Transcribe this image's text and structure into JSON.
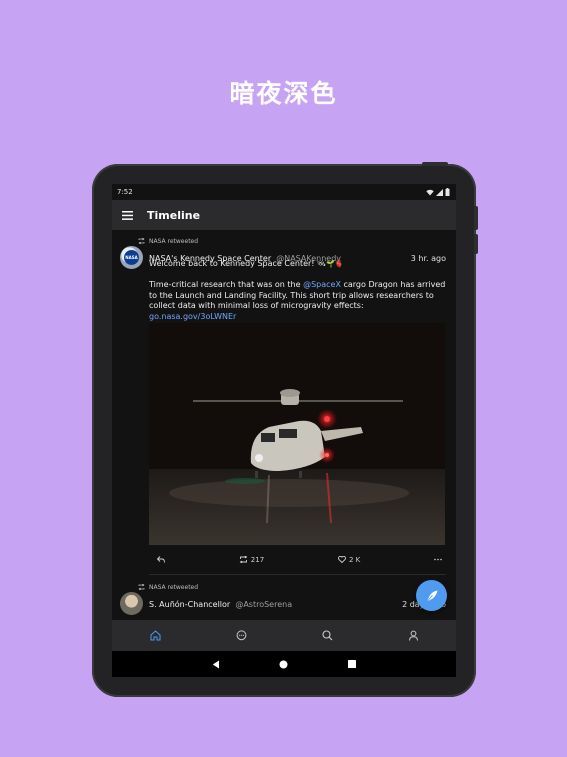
{
  "headline": "暗夜深色",
  "status_bar": {
    "time": "7:52"
  },
  "app_bar": {
    "title": "Timeline",
    "menu_icon": "hamburger-menu-icon"
  },
  "posts": [
    {
      "retweet_label": "NASA retweeted",
      "author_name": "NASA's Kennedy Space Center",
      "author_handle": "@NASAKennedy",
      "time": "3 hr. ago",
      "text_line1": "Welcome back to Kennedy Space Center!",
      "text_line1_emoji": "🛰🌱🫀",
      "text_para2_before_mention": "Time-critical research that was on the ",
      "mention": "@SpaceX",
      "text_para2_after_mention": " cargo Dragon has arrived to the Launch and Landing Facility. This short trip allows researchers to collect data with minimal loss of microgravity effects:",
      "link": "go.nasa.gov/3oLWNEr",
      "media_description": "helicopter on runway at night",
      "reply_icon": "reply-icon",
      "retweet_count": "217",
      "like_count": "2 K",
      "more_icon": "more-horizontal-icon"
    },
    {
      "retweet_label": "NASA retweeted",
      "author_name": "S. Auñón-Chancellor",
      "author_handle": "@AstroSerena",
      "time": "2 days ago"
    }
  ],
  "fab_icon": "compose-quill-icon",
  "bottom_nav": [
    "home-icon",
    "messages-icon",
    "search-icon",
    "profile-icon"
  ],
  "colors": {
    "background": "#c7a3f3",
    "surface": "#121212",
    "bar": "#2b2b2d",
    "accent": "#4e9bf0",
    "link": "#6fa8ff"
  }
}
